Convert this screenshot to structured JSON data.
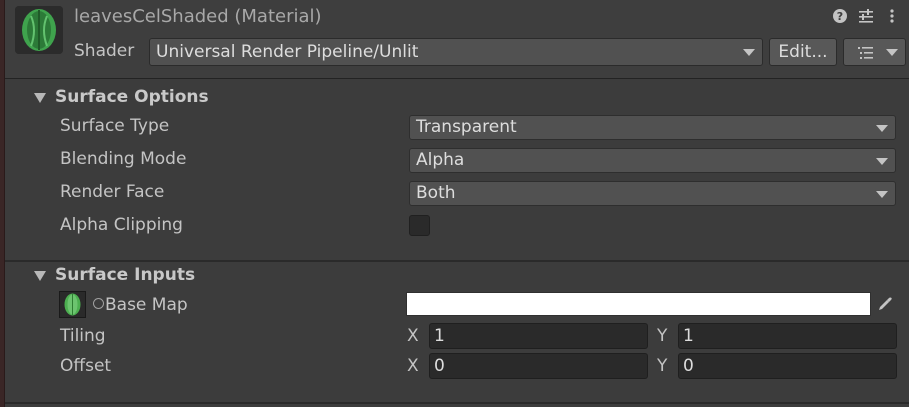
{
  "header": {
    "title": "leavesCelShaded (Material)",
    "shader_label": "Shader",
    "shader_value": "Universal Render Pipeline/Unlit",
    "edit_label": "Edit...",
    "icons": [
      "help-icon",
      "preset-sliders-icon",
      "more-vertical-icon",
      "list-icon"
    ]
  },
  "surface_options": {
    "title": "Surface Options",
    "rows": [
      {
        "label": "Surface Type",
        "value": "Transparent"
      },
      {
        "label": "Blending Mode",
        "value": "Alpha"
      },
      {
        "label": "Render Face",
        "value": "Both"
      }
    ],
    "alpha_clipping": {
      "label": "Alpha Clipping",
      "checked": false
    }
  },
  "surface_inputs": {
    "title": "Surface Inputs",
    "base_map": {
      "label": "Base Map",
      "color": "#ffffff"
    },
    "tiling": {
      "label": "Tiling",
      "x_label": "X",
      "x": "1",
      "y_label": "Y",
      "y": "1"
    },
    "offset": {
      "label": "Offset",
      "x_label": "X",
      "x": "0",
      "y_label": "Y",
      "y": "0"
    }
  },
  "colors": {
    "background": "#3c3c3c",
    "field": "#515151",
    "input": "#2a2a2a",
    "leaf_green": "#4caf50"
  }
}
